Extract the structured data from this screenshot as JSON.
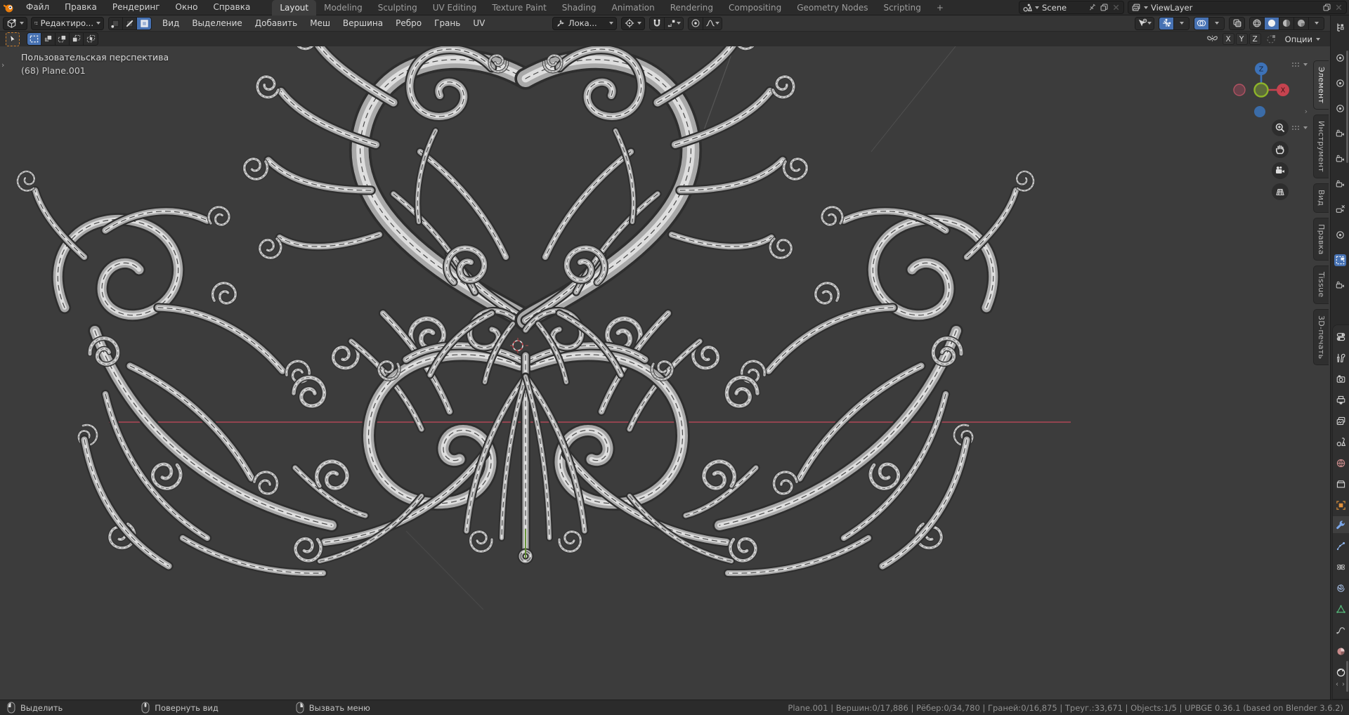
{
  "topbar": {
    "menus": [
      {
        "label": "Файл"
      },
      {
        "label": "Правка"
      },
      {
        "label": "Рендеринг"
      },
      {
        "label": "Окно"
      },
      {
        "label": "Справка"
      }
    ],
    "workspace_tabs": [
      {
        "label": "Layout",
        "active": true
      },
      {
        "label": "Modeling"
      },
      {
        "label": "Sculpting"
      },
      {
        "label": "UV Editing"
      },
      {
        "label": "Texture Paint"
      },
      {
        "label": "Shading"
      },
      {
        "label": "Animation"
      },
      {
        "label": "Rendering"
      },
      {
        "label": "Compositing"
      },
      {
        "label": "Geometry Nodes"
      },
      {
        "label": "Scripting"
      }
    ],
    "add_workspace_label": "+",
    "scene_selector": {
      "value": "Scene"
    },
    "view_layer_selector": {
      "value": "ViewLayer"
    }
  },
  "viewport_header": {
    "mode_selector": {
      "value": "Редактиро..."
    },
    "menus": [
      {
        "label": "Вид"
      },
      {
        "label": "Выделение"
      },
      {
        "label": "Добавить"
      },
      {
        "label": "Меш"
      },
      {
        "label": "Вершина"
      },
      {
        "label": "Ребро"
      },
      {
        "label": "Грань"
      },
      {
        "label": "UV"
      }
    ],
    "transform_orientation": {
      "value": "Лока..."
    }
  },
  "tool_settings": {
    "mirror_axes": [
      {
        "label": "X"
      },
      {
        "label": "Y"
      },
      {
        "label": "Z"
      }
    ],
    "options_label": "Опции"
  },
  "viewport": {
    "view_label": "Пользовательская перспектива",
    "object_label": "(68) Plane.001",
    "gizmo": {
      "x_label": "X",
      "z_label": "Z"
    },
    "sidebar_tabs": [
      {
        "label": "Элемент",
        "active": true
      },
      {
        "label": "Инструмент"
      },
      {
        "label": "Вид"
      },
      {
        "label": "Правка"
      },
      {
        "label": "Tissue"
      },
      {
        "label": "3D-печать"
      }
    ]
  },
  "statusbar": {
    "hints": [
      {
        "button": "left",
        "label": "Выделить"
      },
      {
        "button": "middle",
        "label": "Повернуть вид"
      },
      {
        "button": "right",
        "label": "Вызвать меню"
      }
    ],
    "stats": {
      "object": "Plane.001",
      "verts": "Вершин:0/17,886",
      "edges": "Рёбер:0/34,780",
      "faces": "Граней:0/16,875",
      "tris": "Треуг.:33,671",
      "objects": "Objects:1/5",
      "version": "UPBGE 0.36.1 (based on Blender 3.6.2)"
    },
    "stats_text": "Plane.001 | Вершин:0/17,886 | Рёбер:0/34,780 | Граней:0/16,875 | Треуг.:33,671 | Objects:1/5 | UPBGE 0.36.1 (based on Blender 3.6.2)"
  },
  "colors": {
    "accent": "#4772b3",
    "axis_x": "#c24a5c",
    "axis_y": "#5c8c28",
    "viewport_bg": "#3c3c3c",
    "topbar_bg": "#2b2b2b"
  }
}
